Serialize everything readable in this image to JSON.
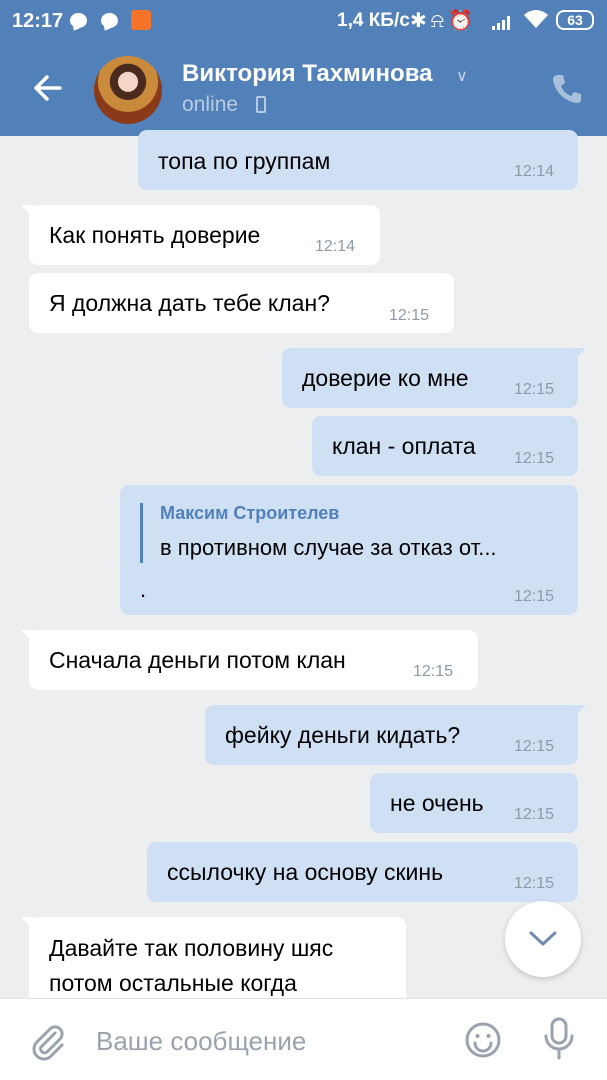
{
  "status_bar": {
    "time": "12:17",
    "network_speed": "1,4 КБ/с",
    "battery": "63",
    "icons": [
      "chat-bubble-icon",
      "chat-bubble-icon",
      "app-notification-icon",
      "bluetooth-icon",
      "mute-icon",
      "alarm-icon",
      "signal-icon",
      "wifi-icon",
      "battery-icon"
    ]
  },
  "header": {
    "contact_name": "Виктория Тахминова",
    "status": "online",
    "accent_color": "#5181b8"
  },
  "messages": [
    {
      "direction": "out",
      "text": "топа по группам",
      "time": "12:14"
    },
    {
      "direction": "in",
      "text": "Как понять доверие",
      "time": "12:14"
    },
    {
      "direction": "in",
      "text": "Я должна дать тебе клан?",
      "time": "12:15"
    },
    {
      "direction": "out",
      "text": "доверие ко мне",
      "time": "12:15"
    },
    {
      "direction": "out",
      "text": "клан - оплата",
      "time": "12:15"
    },
    {
      "direction": "out",
      "reply_author": "Максим Строителев",
      "reply_text": "в противном случае за отказ от...",
      "text": ".",
      "time": "12:15"
    },
    {
      "direction": "in",
      "text": "Сначала деньги потом клан",
      "time": "12:15"
    },
    {
      "direction": "out",
      "text": "фейку деньги кидать?",
      "time": "12:15"
    },
    {
      "direction": "out",
      "text": "не очень",
      "time": "12:15"
    },
    {
      "direction": "out",
      "text": "ссылочку на основу скинь",
      "time": "12:15"
    },
    {
      "direction": "in",
      "text_lines": [
        "Давайте так половину шяс",
        "потом остальные когда"
      ]
    }
  ],
  "composer": {
    "placeholder": "Ваше сообщение"
  }
}
